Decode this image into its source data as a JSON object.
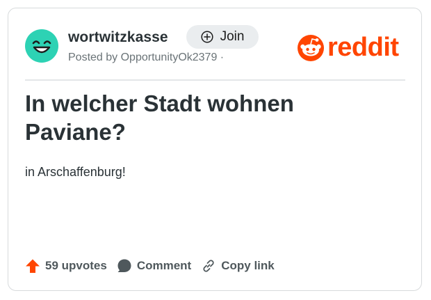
{
  "post": {
    "subreddit": "wortwitzkasse",
    "join_label": "Join",
    "posted_by": "Posted by OpportunityOk2379 ·",
    "title": "In welcher Stadt wohnen Paviane?",
    "body": "in Arschaffenburg!"
  },
  "brand": {
    "logo_text": "reddit",
    "accent": "#ff4500"
  },
  "actions": {
    "upvotes_label": "59 upvotes",
    "comment_label": "Comment",
    "copy_link_label": "Copy link"
  },
  "icons": {
    "avatar": "subreddit-avatar-icon",
    "join": "plus-circle-icon",
    "upvote": "upvote-arrow-icon",
    "comment": "comment-bubble-icon",
    "copy_link": "link-icon"
  }
}
